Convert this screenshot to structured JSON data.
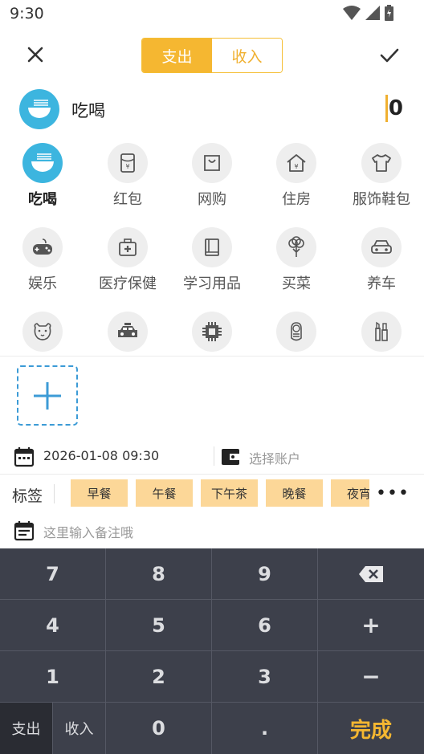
{
  "status_bar": {
    "time": "9:30"
  },
  "header": {
    "tabs": [
      {
        "label": "支出",
        "active": true
      },
      {
        "label": "收入",
        "active": false
      }
    ]
  },
  "selected": {
    "name": "吃喝",
    "amount": "0"
  },
  "categories": [
    {
      "label": "吃喝",
      "icon": "noodle-bowl-icon"
    },
    {
      "label": "红包",
      "icon": "red-envelope-icon"
    },
    {
      "label": "网购",
      "icon": "shopping-bag-icon"
    },
    {
      "label": "住房",
      "icon": "house-icon"
    },
    {
      "label": "服饰鞋包",
      "icon": "tshirt-icon"
    },
    {
      "label": "娱乐",
      "icon": "gamepad-icon"
    },
    {
      "label": "医疗保健",
      "icon": "first-aid-kit-icon"
    },
    {
      "label": "学习用品",
      "icon": "book-icon"
    },
    {
      "label": "买菜",
      "icon": "vegetable-icon"
    },
    {
      "label": "养车",
      "icon": "car-icon"
    },
    {
      "label": "",
      "icon": "pet-dog-icon"
    },
    {
      "label": "",
      "icon": "taxi-icon"
    },
    {
      "label": "",
      "icon": "chip-icon"
    },
    {
      "label": "",
      "icon": "baby-icon"
    },
    {
      "label": "",
      "icon": "cosmetics-icon"
    }
  ],
  "details": {
    "date": "2026-01-08 09:30",
    "account_placeholder": "选择账户",
    "tags_label": "标签",
    "tags": [
      "早餐",
      "午餐",
      "下午茶",
      "晚餐",
      "夜宵"
    ],
    "more": "•••",
    "note_placeholder": "这里输入备注哦"
  },
  "keypad": {
    "keys": [
      "7",
      "8",
      "9",
      "",
      "4",
      "5",
      "6",
      "+",
      "1",
      "2",
      "3",
      "−",
      "0",
      "."
    ],
    "expense_label": "支出",
    "income_label": "收入",
    "done_label": "完成"
  },
  "colors": {
    "accent": "#f5b731",
    "blue": "#3cb5df",
    "keypad_bg": "#3d404b"
  }
}
